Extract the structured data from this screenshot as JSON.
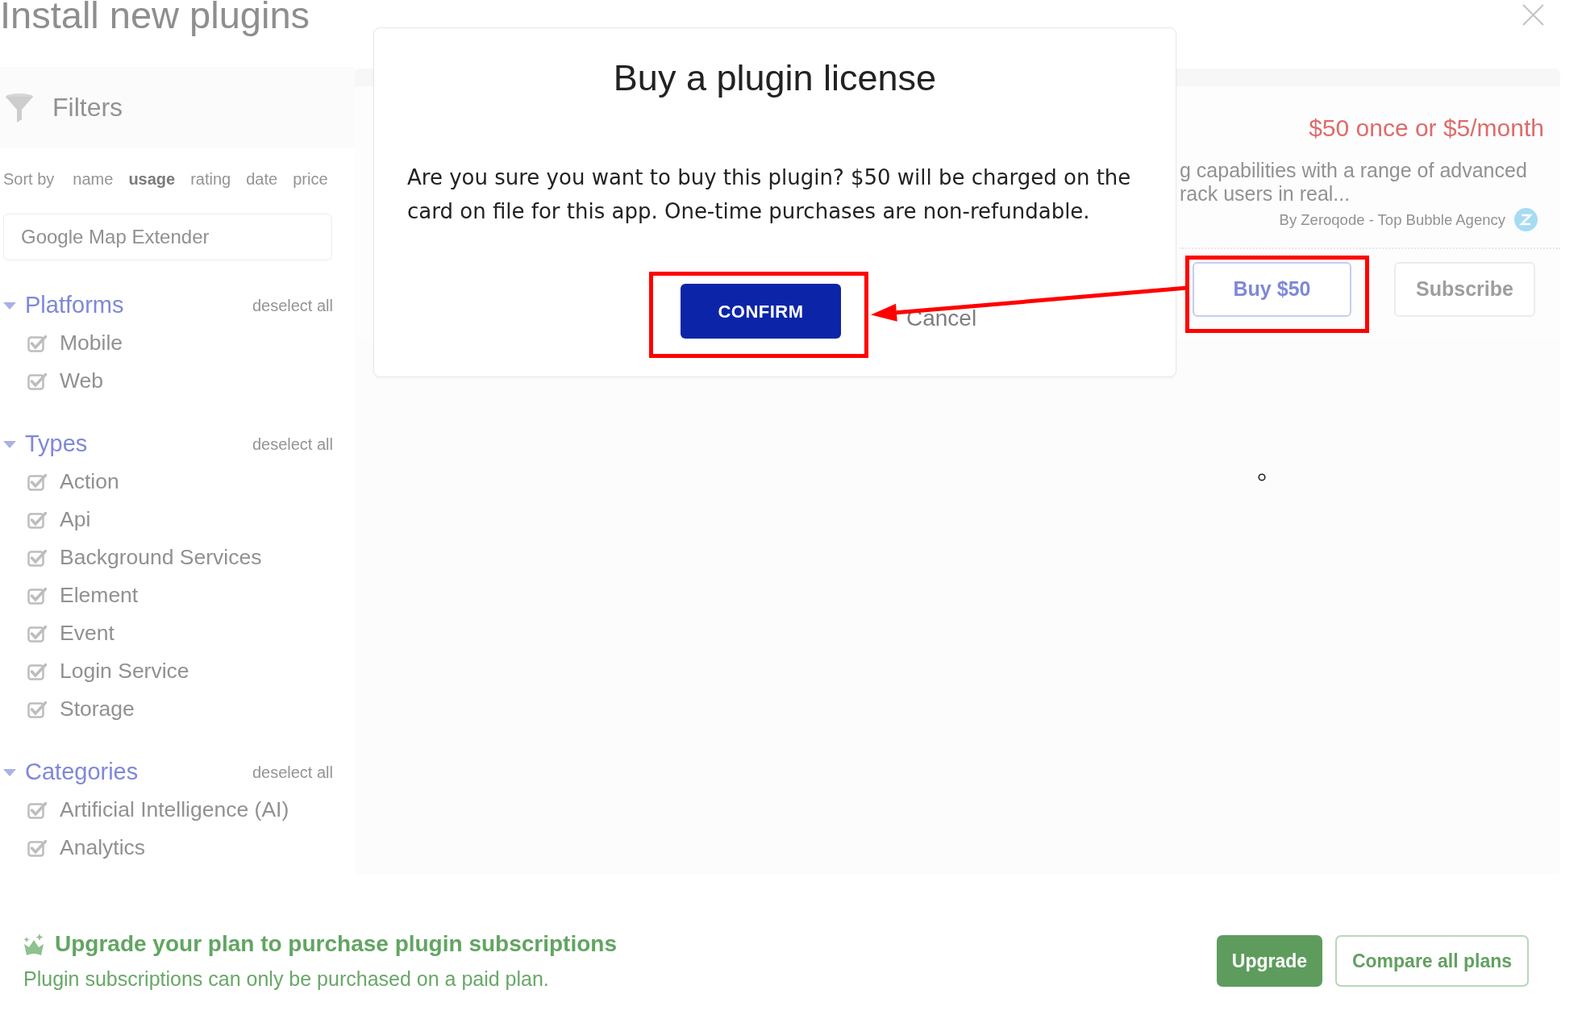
{
  "page": {
    "title": "Install new plugins"
  },
  "filters": {
    "title": "Filters",
    "sort": {
      "label": "Sort by",
      "options": [
        {
          "label": "name",
          "selected": false
        },
        {
          "label": "usage",
          "selected": true
        },
        {
          "label": "rating",
          "selected": false
        },
        {
          "label": "date",
          "selected": false
        },
        {
          "label": "price",
          "selected": false
        }
      ]
    },
    "search": {
      "value": "Google Map Extender"
    },
    "groups": [
      {
        "title": "Platforms",
        "action": "deselect all",
        "expanded": true,
        "items": [
          {
            "label": "Mobile",
            "checked": true
          },
          {
            "label": "Web",
            "checked": true
          }
        ]
      },
      {
        "title": "Types",
        "action": "deselect all",
        "expanded": true,
        "items": [
          {
            "label": "Action",
            "checked": true
          },
          {
            "label": "Api",
            "checked": true
          },
          {
            "label": "Background Services",
            "checked": true
          },
          {
            "label": "Element",
            "checked": true
          },
          {
            "label": "Event",
            "checked": true
          },
          {
            "label": "Login Service",
            "checked": true
          },
          {
            "label": "Storage",
            "checked": true
          }
        ]
      },
      {
        "title": "Categories",
        "action": "deselect all",
        "expanded": true,
        "items": [
          {
            "label": "Artificial Intelligence (AI)",
            "checked": true
          },
          {
            "label": "Analytics",
            "checked": true
          }
        ]
      }
    ]
  },
  "plugin_card": {
    "price": "$50 once or $5/month",
    "description_lines": [
      "g capabilities with a range of advanced",
      "rack users in real..."
    ],
    "author": "By Zeroqode - Top Bubble Agency",
    "buttons": [
      {
        "label": "Buy $50",
        "disabled": false,
        "highlighted": true
      },
      {
        "label": "Subscribe",
        "disabled": true,
        "highlighted": false
      }
    ]
  },
  "modal": {
    "title": "Buy a plugin license",
    "message": "Are you sure you want to buy this plugin? $50 will be charged on the card on file for this app. One-time purchases are non-refundable.",
    "buttons": [
      {
        "label": "CONFIRM",
        "kind": "primary",
        "highlighted": true
      },
      {
        "label": "Cancel",
        "kind": "link",
        "highlighted": false
      }
    ]
  },
  "upgrade_banner": {
    "title": "Upgrade your plan to purchase plugin subscriptions",
    "subtitle": "Plugin subscriptions can only be purchased on a paid plan.",
    "buttons": [
      {
        "label": "Upgrade",
        "kind": "solid"
      },
      {
        "label": "Compare all plans",
        "kind": "outline"
      }
    ]
  },
  "annotation": {
    "arrow": true
  }
}
